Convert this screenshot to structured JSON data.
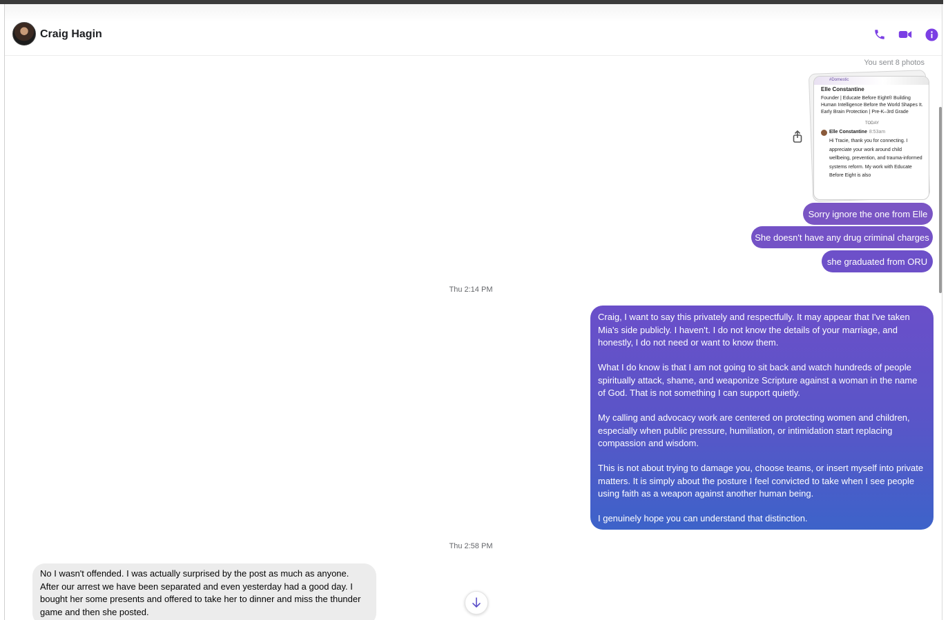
{
  "header": {
    "contact_name": "Craig Hagin",
    "icons": [
      "phone-icon",
      "video-icon",
      "info-icon"
    ],
    "accent_color": "#7b3fe4"
  },
  "conversation": {
    "sent_photos_label": "You sent 8 photos",
    "photo_preview": {
      "top_tag": "#Domestic",
      "profile_name": "Elle Constantine",
      "headline": "Founder | Educate Before Eight® Building Human Intelligence Before the World Shapes It. Early Brain Protection | Pre-K–3rd Grade",
      "day_label": "TODAY",
      "sender": "Elle Constantine",
      "time": "8:53am",
      "message": "Hi Tracie, thank you for connecting. I appreciate your work around child wellbeing, prevention, and trauma-informed systems reform. My work with Educate Before Eight is also"
    },
    "sent_messages": [
      "Sorry ignore the one from Elle",
      "She doesn't have any drug criminal charges",
      "she graduated from ORU"
    ],
    "timestamp_1": "Thu 2:14 PM",
    "long_message": {
      "p1": "Craig, I want to say this privately and respectfully. It may appear that I've taken Mia's side publicly. I haven't. I do not know the details of your marriage, and honestly, I do not need or want to know them.",
      "p2": "What I do know is that I am not going to sit back and watch hundreds of people spiritually attack, shame, and weaponize Scripture against a woman in the name of God. That is not something I can support quietly.",
      "p3": "My calling and advocacy work are centered on protecting women and children, especially when public pressure, humiliation, or intimidation start replacing compassion and wisdom.",
      "p4": "This is not about trying to damage you, choose teams, or insert myself into private matters. It is simply about the posture I feel convicted to take when I see people using faith as a weapon against another human being.",
      "p5": "I genuinely hope you can understand that distinction."
    },
    "timestamp_2": "Thu 2:58 PM",
    "received_message": "No I wasn't offended. I was actually surprised by the post as much as anyone.  After our arrest we have been separated and even yesterday had a good day. I bought her some presents and offered to take her to dinner and miss the thunder game and then she posted."
  }
}
